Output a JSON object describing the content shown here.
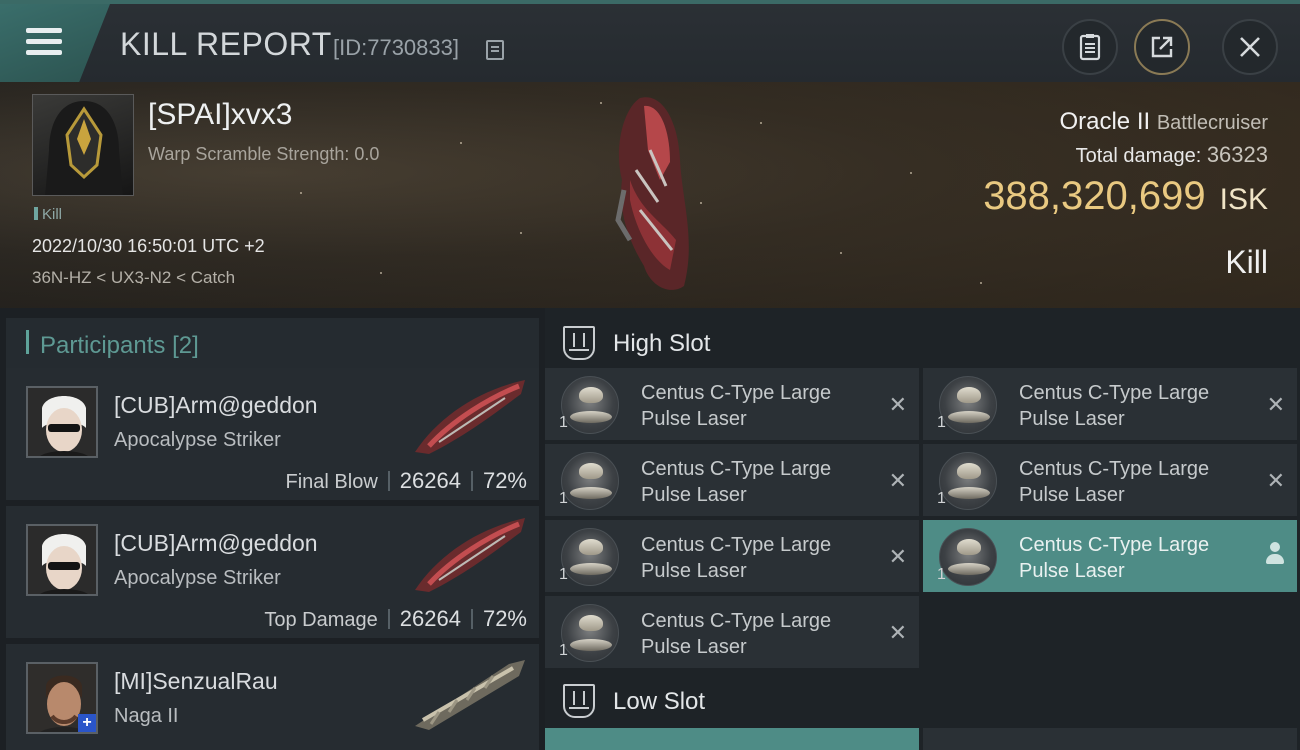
{
  "header": {
    "title": "KILL REPORT",
    "id_text": "[ID:7730833]"
  },
  "victim": {
    "name": "[SPAI]xvx3",
    "warp_scramble": "Warp Scramble Strength: 0.0",
    "tag": "Kill",
    "datetime": "2022/10/30 16:50:01 UTC +2",
    "location": "36N-HZ < UX3-N2 < Catch",
    "ship_name": "Oracle II",
    "ship_class": "Battlecruiser",
    "total_damage_label": "Total damage:",
    "total_damage": "36323",
    "isk_value": "388,320,699",
    "isk_unit": "ISK",
    "status": "Kill"
  },
  "participants": {
    "label": "Participants",
    "count": "[2]",
    "items": [
      {
        "name": "[CUB]Arm@geddon",
        "ship": "Apocalypse Striker",
        "role": "Final Blow",
        "damage": "26264",
        "percent": "72%"
      },
      {
        "name": "[CUB]Arm@geddon",
        "ship": "Apocalypse Striker",
        "role": "Top Damage",
        "damage": "26264",
        "percent": "72%"
      },
      {
        "name": "[MI]SenzualRau",
        "ship": "Naga II",
        "role": "",
        "damage": "",
        "percent": ""
      }
    ]
  },
  "slots": {
    "high_label": "High Slot",
    "low_label": "Low Slot",
    "high_items": [
      {
        "line1": "Centus C-Type Large",
        "line2": "Pulse Laser",
        "qty": "1"
      },
      {
        "line1": "Centus C-Type Large",
        "line2": "Pulse Laser",
        "qty": "1"
      },
      {
        "line1": "Centus C-Type Large",
        "line2": "Pulse Laser",
        "qty": "1"
      },
      {
        "line1": "Centus C-Type Large",
        "line2": "Pulse Laser",
        "qty": "1"
      },
      {
        "line1": "Centus C-Type Large",
        "line2": "Pulse Laser",
        "qty": "1"
      },
      {
        "line1": "Centus C-Type Large",
        "line2": "Pulse Laser",
        "qty": "1"
      },
      {
        "line1": "Centus C-Type Large",
        "line2": "Pulse Laser",
        "qty": "1"
      }
    ]
  },
  "icons": {
    "menu": "hamburger-menu-icon",
    "copy": "copy-icon",
    "report": "clipboard-icon",
    "share": "share-icon",
    "close": "close-icon",
    "dropped": "x-icon",
    "pilot": "person-icon",
    "slot": "slot-shield-icon"
  },
  "colors": {
    "accent": "#4e8c86",
    "isk": "#e9c981"
  }
}
